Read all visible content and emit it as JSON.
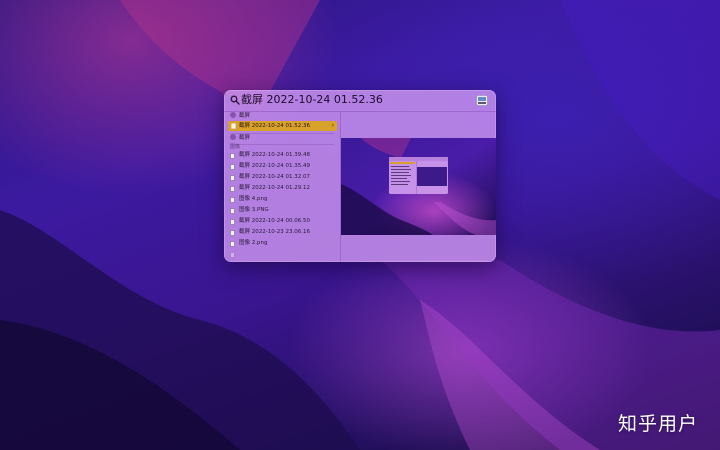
{
  "spotlight": {
    "query": "截屏 2022-10-24 01.52.36",
    "top_hit_section": "截屏",
    "top_hit_label": "截屏 2022-10-24 01.52.36",
    "second_section": "截屏",
    "documents_header": "图像",
    "results": [
      "截屏 2022-10-24 01.39.48",
      "截屏 2022-10-24 01.35.49",
      "截屏 2022-10-24 01.32.07",
      "截屏 2022-10-24 01.29.12",
      "图像 4.png",
      "图像 3.PNG",
      "截屏 2022-10-24 00.06.50",
      "截屏 2022-10-23 23.06.16",
      "图像 2.png"
    ]
  },
  "watermark": "知乎用户",
  "colors": {
    "selection": "#d7a12a",
    "panel": "#cd96f0"
  }
}
